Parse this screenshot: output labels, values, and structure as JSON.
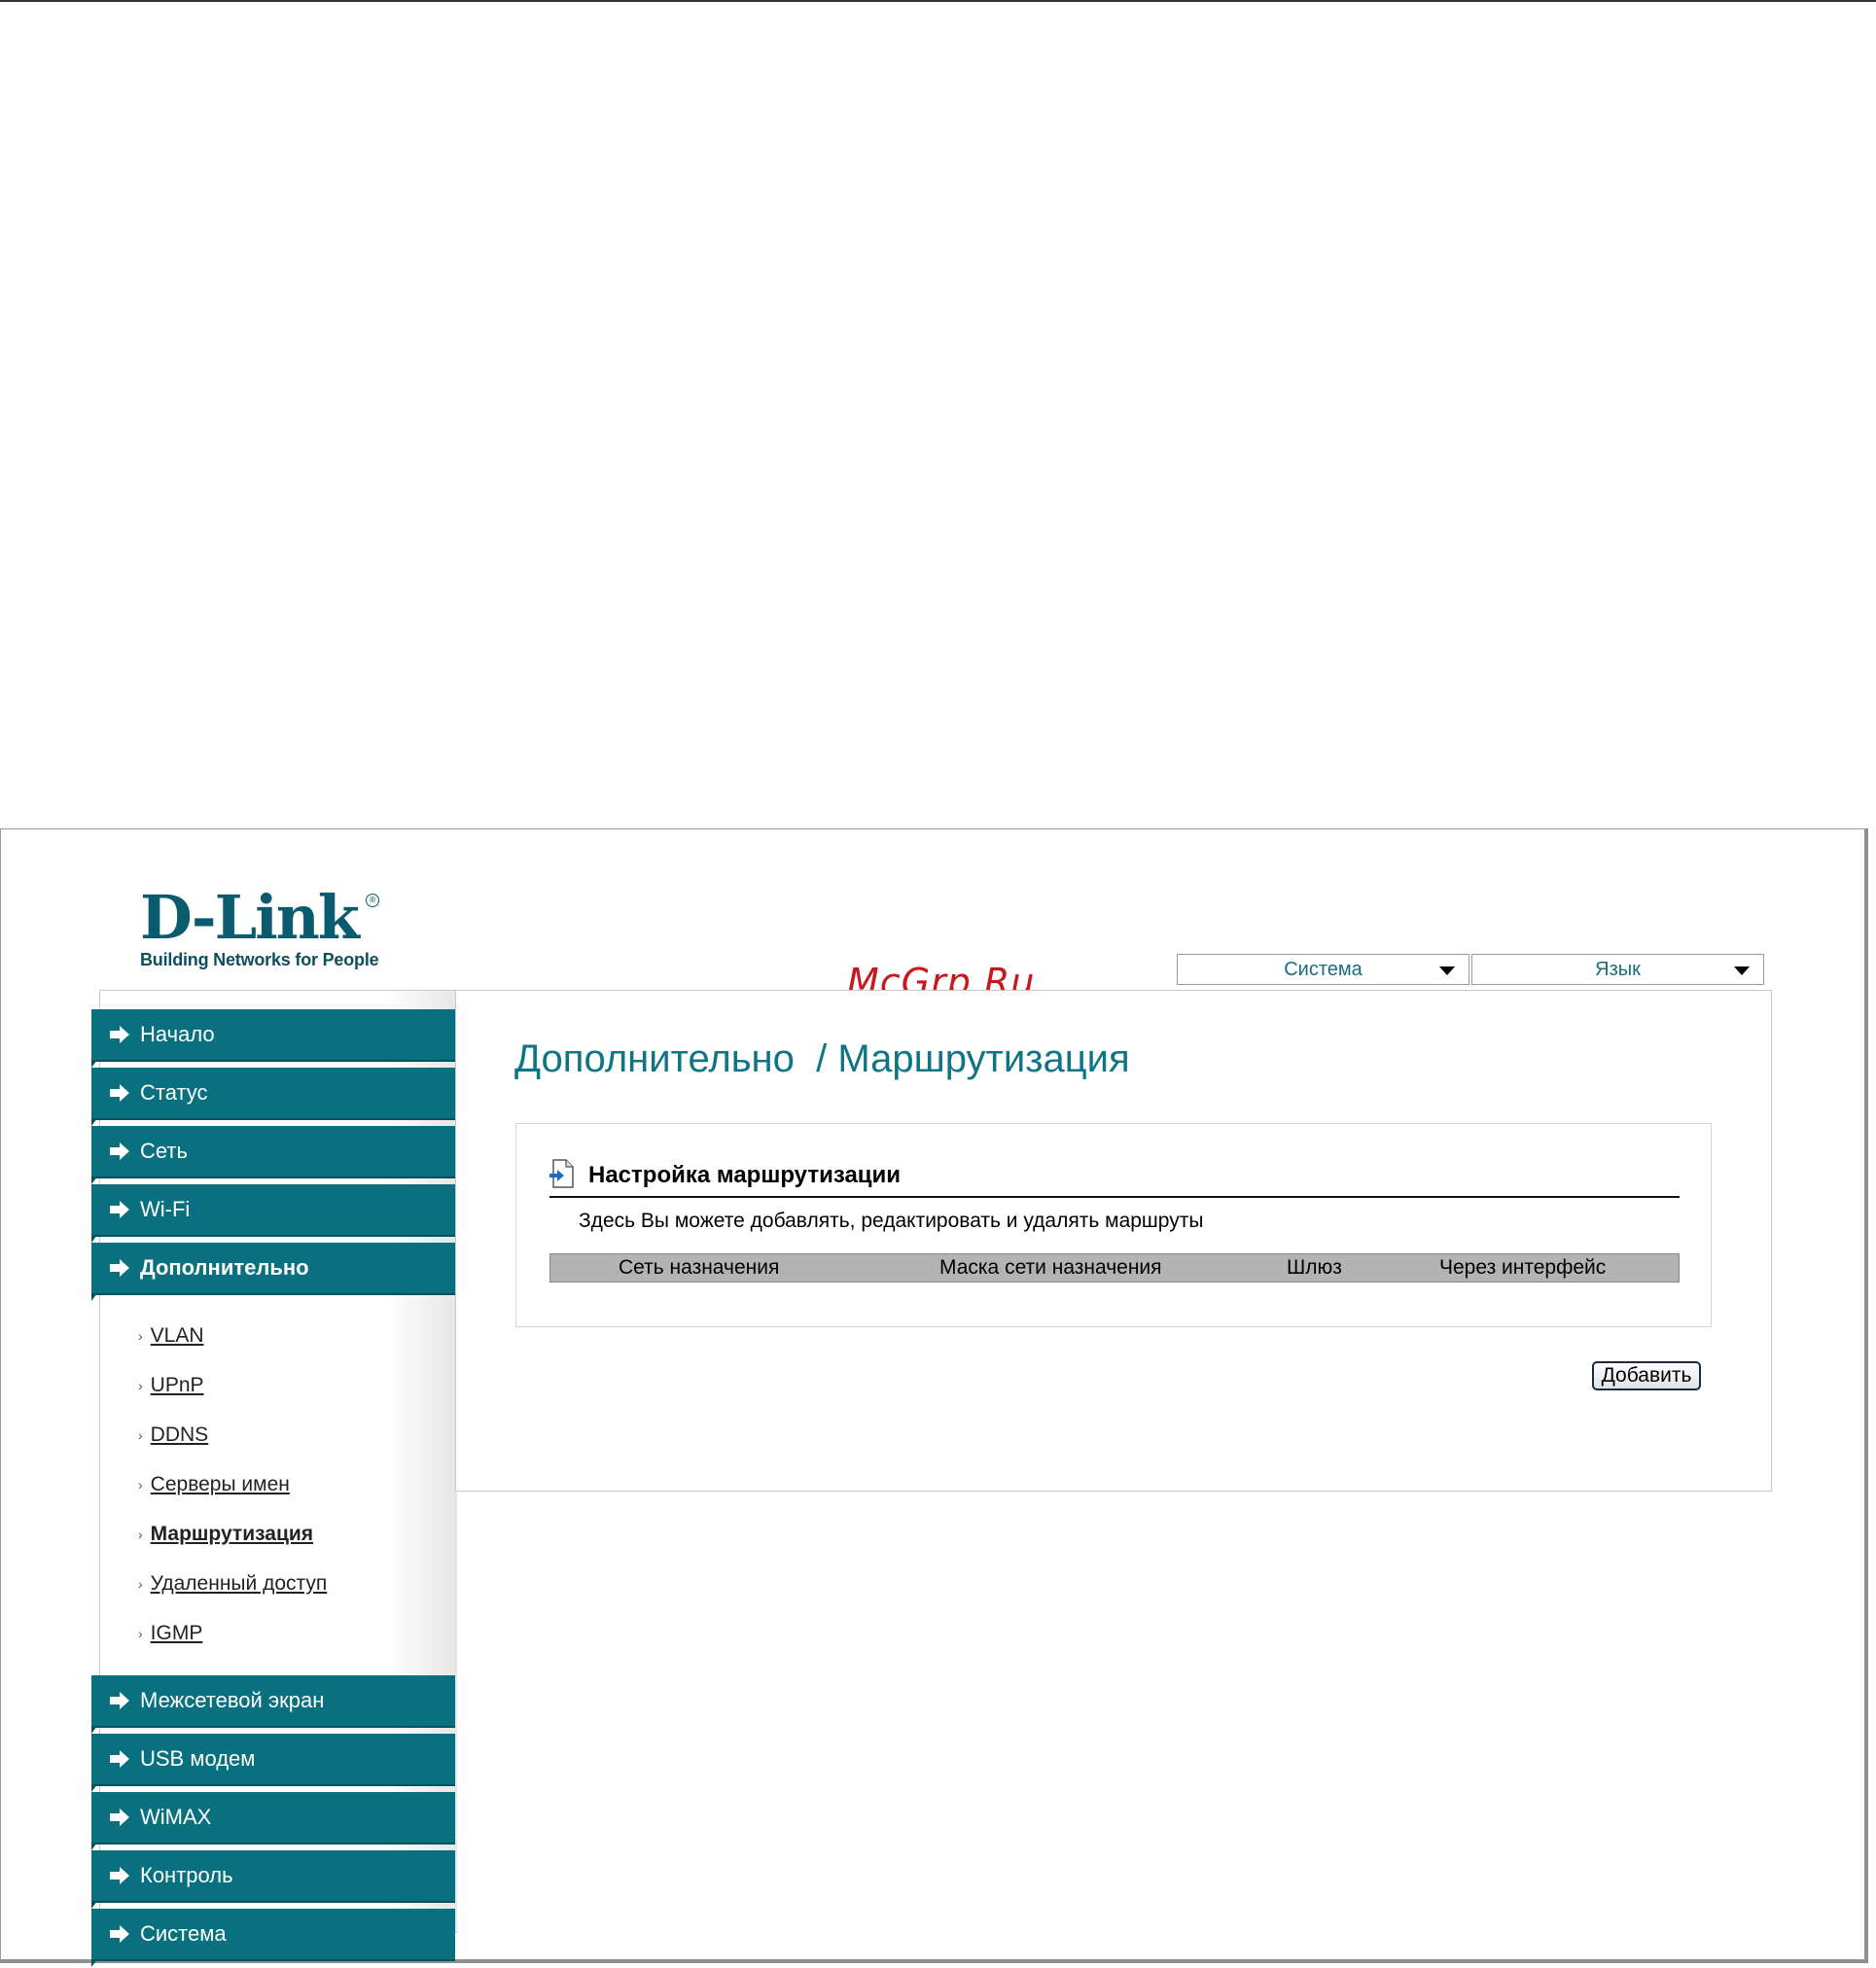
{
  "brand": {
    "name": "D-Link",
    "tagline": "Building Networks for People",
    "registered": "®"
  },
  "watermark": "McGrp.Ru",
  "top_selects": [
    {
      "label": "Система"
    },
    {
      "label": "Язык"
    }
  ],
  "sidebar": {
    "items_top": [
      {
        "label": "Начало"
      },
      {
        "label": "Статус"
      },
      {
        "label": "Сеть"
      },
      {
        "label": "Wi-Fi"
      },
      {
        "label": "Дополнительно",
        "active": true
      }
    ],
    "subitems": [
      {
        "label": "VLAN"
      },
      {
        "label": "UPnP"
      },
      {
        "label": "DDNS"
      },
      {
        "label": "Серверы имен"
      },
      {
        "label": "Маршрутизация",
        "active": true
      },
      {
        "label": "Удаленный доступ"
      },
      {
        "label": "IGMP"
      }
    ],
    "items_bottom": [
      {
        "label": "Межсетевой экран"
      },
      {
        "label": "USB модем"
      },
      {
        "label": "WiMAX"
      },
      {
        "label": "Контроль"
      },
      {
        "label": "Система"
      }
    ]
  },
  "content": {
    "title": "Дополнительно  / Маршрутизация",
    "section_title": "Настройка маршрутизации",
    "description": "Здесь Вы можете добавлять, редактировать и удалять маршруты",
    "columns": [
      "Сеть назначения",
      "Маска сети назначения",
      "Шлюз",
      "Через интерфейс"
    ],
    "add_button": "Добавить"
  },
  "colors": {
    "accent": "#09707f",
    "title": "#0f7585",
    "watermark": "#c8181e"
  }
}
